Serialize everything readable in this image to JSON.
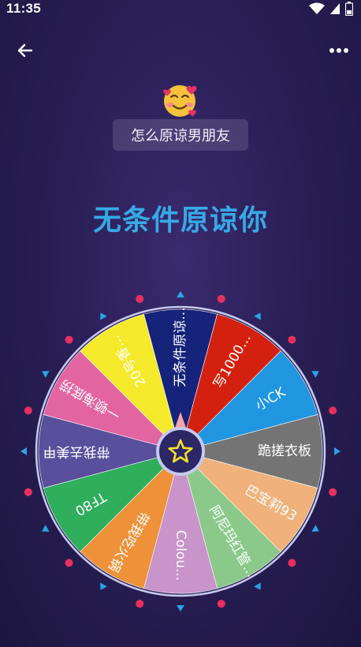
{
  "status": {
    "time": "11:35",
    "icons": [
      "wifi-icon",
      "signal-icon",
      "battery-icon"
    ]
  },
  "app_bar": {
    "back_icon": "arrow-left-icon",
    "more_icon": "more-vert-icon"
  },
  "topic": {
    "emoji": "smiling-face-with-hearts",
    "title": "怎么原谅男朋友"
  },
  "result": "无条件原谅你",
  "wheel": {
    "center_icon": "star-icon",
    "segments": [
      {
        "label": "无条件原谅...",
        "color": "#15237a"
      },
      {
        "label": "写1000...",
        "color": "#d4210f"
      },
      {
        "label": "小CK",
        "color": "#2196e0"
      },
      {
        "label": "跪搓衣板",
        "color": "#747474"
      },
      {
        "label": "巴宝莉93",
        "color": "#f0b27a"
      },
      {
        "label": "阿尼玛红管...",
        "color": "#8bc98b"
      },
      {
        "label": "Colou...",
        "color": "#c994c9"
      },
      {
        "label": "带我吃火锅",
        "color": "#ee9139"
      },
      {
        "label": "TF80",
        "color": "#2fae5c"
      },
      {
        "label": "带我去美甲",
        "color": "#5a4f9c"
      },
      {
        "label": "一顿海底捞",
        "color": "#e264a0"
      },
      {
        "label": "20号香...",
        "color": "#f5ea2a"
      }
    ]
  }
}
